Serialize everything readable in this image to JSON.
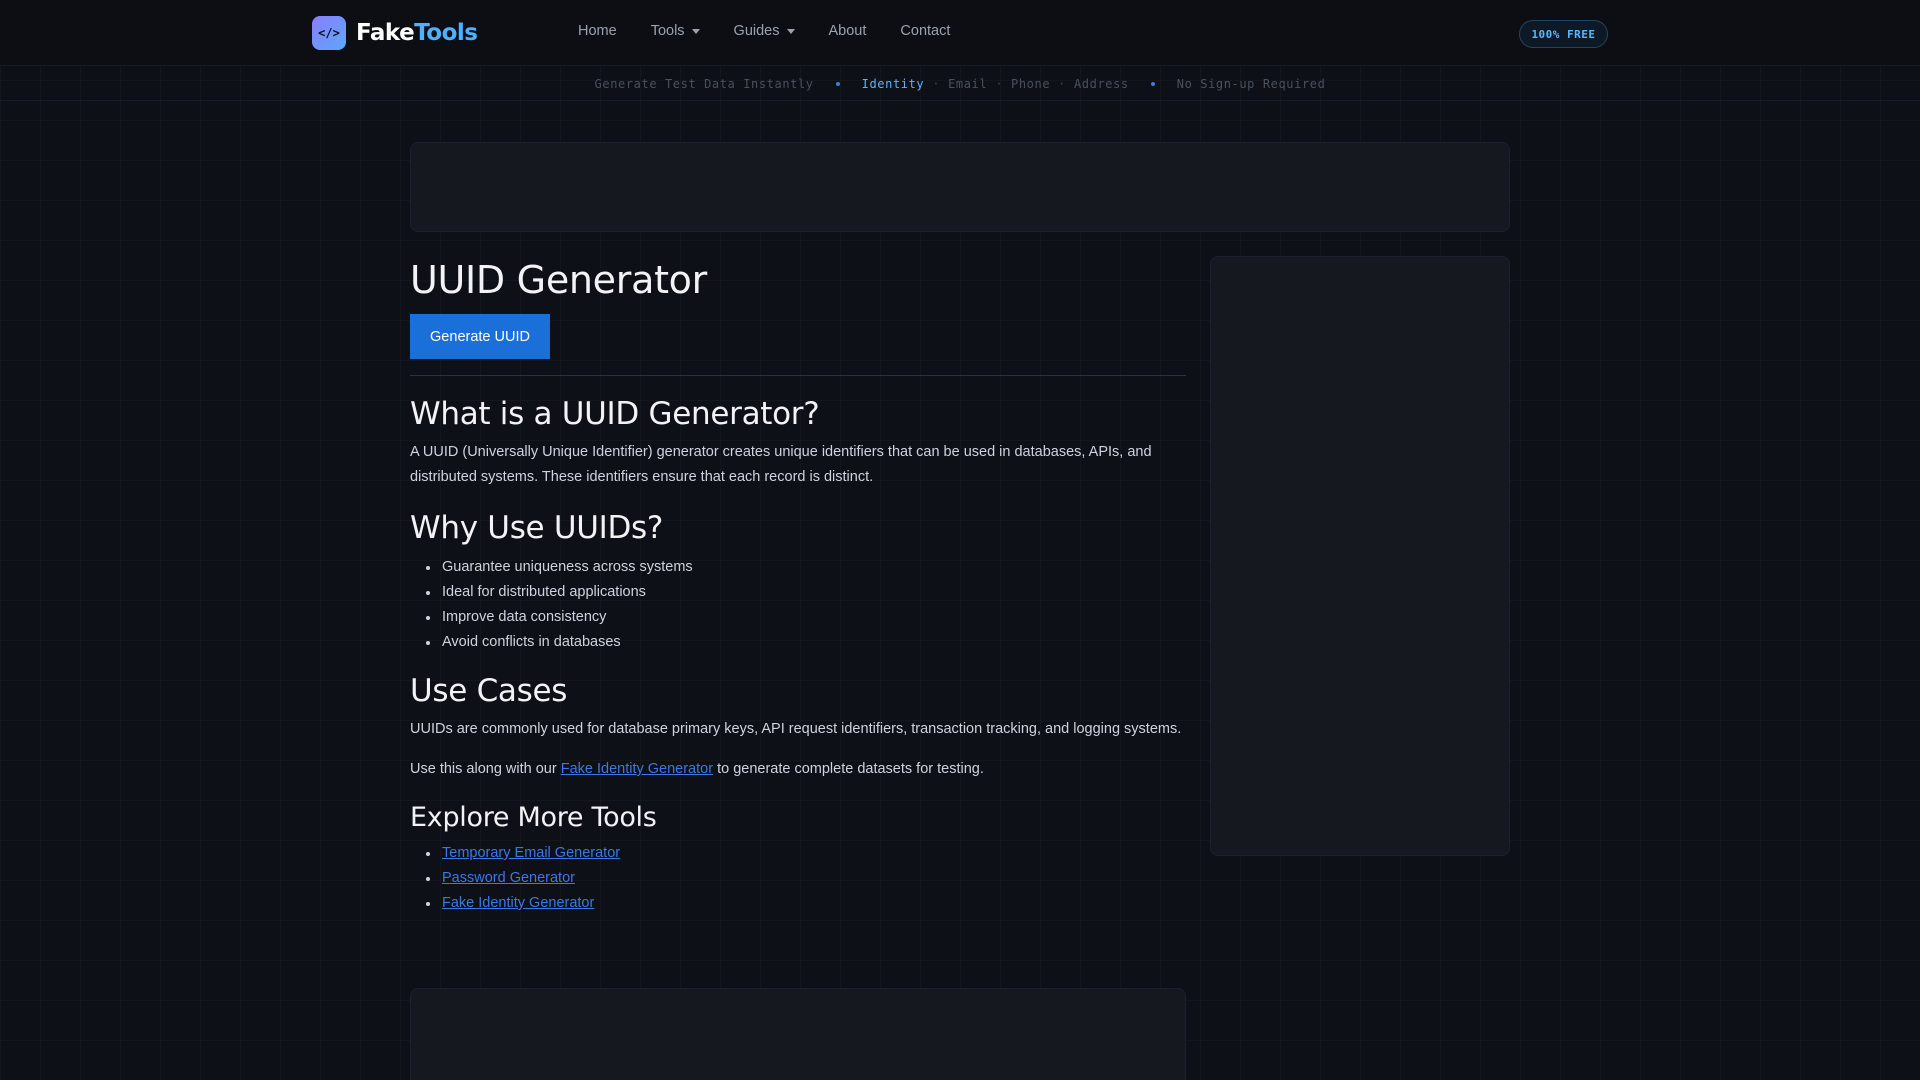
{
  "header": {
    "logo_icon": "</>",
    "logo_fake": "Fake",
    "logo_tools": "Tools",
    "nav": {
      "home": "Home",
      "tools": "Tools",
      "guides": "Guides",
      "about": "About",
      "contact": "Contact"
    },
    "badge": "100% FREE"
  },
  "ticker": {
    "left": "Generate Test Data Instantly",
    "highlight": "Identity",
    "email": "Email",
    "phone": "Phone",
    "address": "Address",
    "separator": "·",
    "right": "No Sign-up Required"
  },
  "main": {
    "title": "UUID Generator",
    "generate_button": "Generate UUID",
    "what_heading": "What is a UUID Generator?",
    "what_text": "A UUID (Universally Unique Identifier) generator creates unique identifiers that can be used in databases, APIs, and distributed systems. These identifiers ensure that each record is distinct.",
    "why_heading": "Why Use UUIDs?",
    "why_items": [
      "Guarantee uniqueness across systems",
      "Ideal for distributed applications",
      "Improve data consistency",
      "Avoid conflicts in databases"
    ],
    "use_heading": "Use Cases",
    "use_text": "UUIDs are commonly used for database primary keys, API request identifiers, transaction tracking, and logging systems.",
    "along_prefix": "Use this along with our ",
    "along_link": "Fake Identity Generator",
    "along_suffix": " to generate complete datasets for testing.",
    "explore_heading": "Explore More Tools",
    "explore_links": [
      "Temporary Email Generator",
      "Password Generator",
      "Fake Identity Generator"
    ]
  },
  "colors": {
    "background": "#0d1016",
    "accent": "#4fb0ff",
    "button": "#1a6fd8",
    "link": "#3b78e8"
  }
}
